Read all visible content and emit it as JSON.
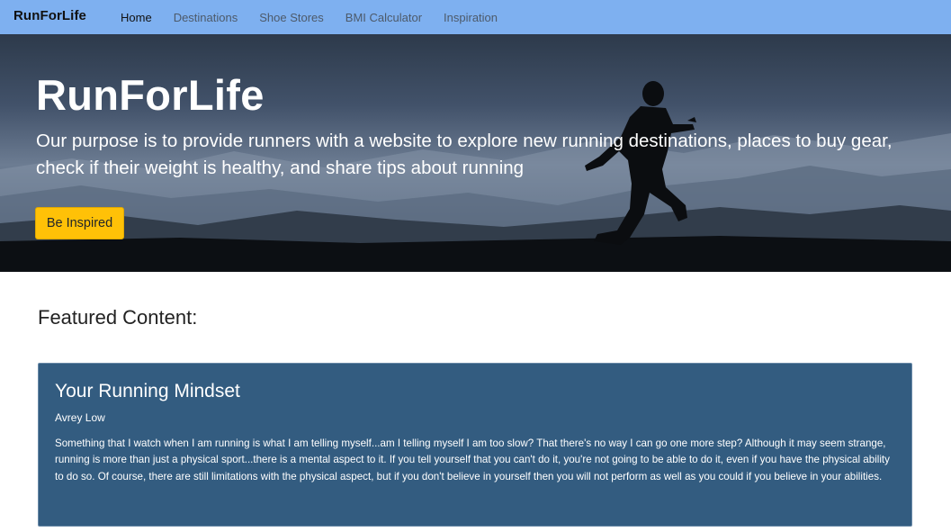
{
  "navbar": {
    "brand": "RunForLife",
    "links": [
      {
        "label": "Home",
        "active": true
      },
      {
        "label": "Destinations",
        "active": false
      },
      {
        "label": "Shoe Stores",
        "active": false
      },
      {
        "label": "BMI Calculator",
        "active": false
      },
      {
        "label": "Inspiration",
        "active": false
      }
    ]
  },
  "hero": {
    "title": "RunForLife",
    "subtitle": "Our purpose is to provide runners with a website to explore new running destinations, places to buy gear, check if their weight is healthy, and share tips about running",
    "button_label": "Be Inspired"
  },
  "featured": {
    "heading": "Featured Content:",
    "card": {
      "title": "Your Running Mindset",
      "author": "Avrey Low",
      "body": "Something that I watch when I am running is what I am telling myself...am I telling myself I am too slow? That there's no way I can go one more step? Although it may seem strange, running is more than just a physical sport...there is a mental aspect to it. If you tell yourself that you can't do it, you're not going to be able to do it, even if you have the physical ability to do so. Of course, there are still limitations with the physical aspect, but if you don't believe in yourself then you will not perform as well as you could if you believe in your abilities."
    }
  },
  "colors": {
    "navbar": "#7eb0f0",
    "button": "#ffc107",
    "card": "#335c80"
  }
}
